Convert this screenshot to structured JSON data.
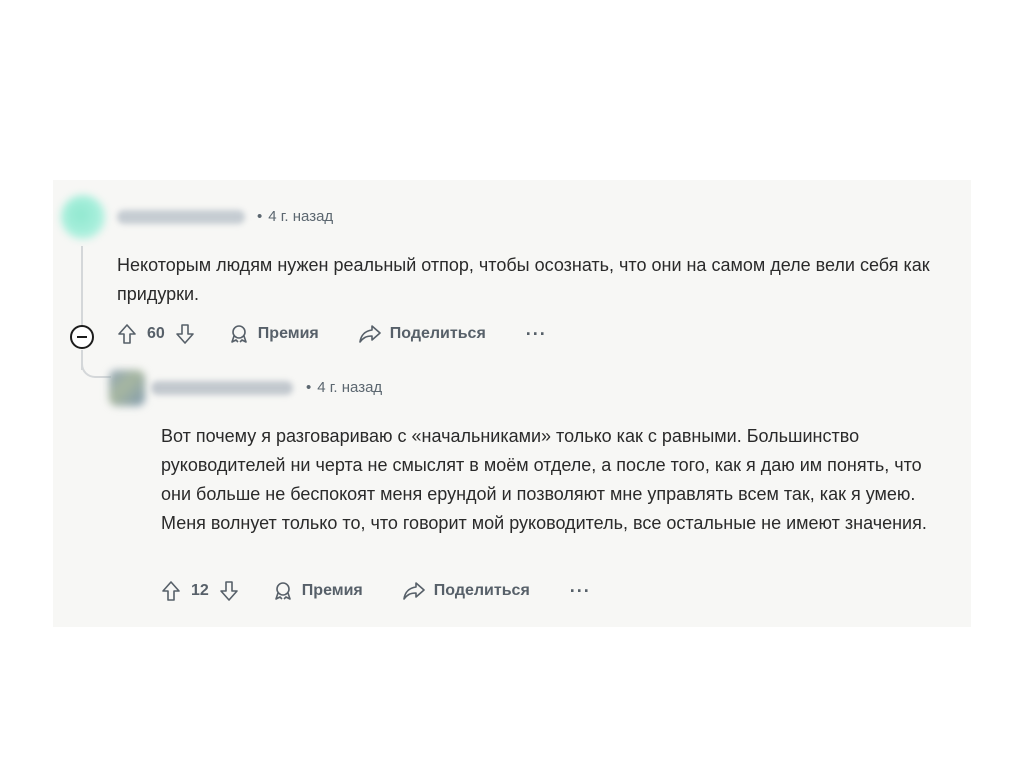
{
  "comments": [
    {
      "time": "4 г. назад",
      "text": "Некоторым людям нужен реальный отпор, чтобы осознать, что они на самом деле вели себя как придурки.",
      "votes": "60",
      "award_label": "Премия",
      "share_label": "Поделиться",
      "more_label": "···"
    },
    {
      "time": "4 г. назад",
      "text": "Вот почему я разговариваю с «начальниками» только как с равными. Большинство руководителей ни черта не смыслят в моём отделе, а после того, как я даю им понять, что они больше не беспокоят меня ерундой и позволяют мне управлять всем так, как я умею. Меня волнует только то, что говорит мой руководитель, все остальные не имеют значения.",
      "votes": "12",
      "award_label": "Премия",
      "share_label": "Поделиться",
      "more_label": "···"
    }
  ],
  "dot": "•",
  "icons": {
    "upvote": "upvote-icon",
    "downvote": "downvote-icon",
    "award": "award-icon",
    "share": "share-icon",
    "collapse": "collapse-icon"
  }
}
